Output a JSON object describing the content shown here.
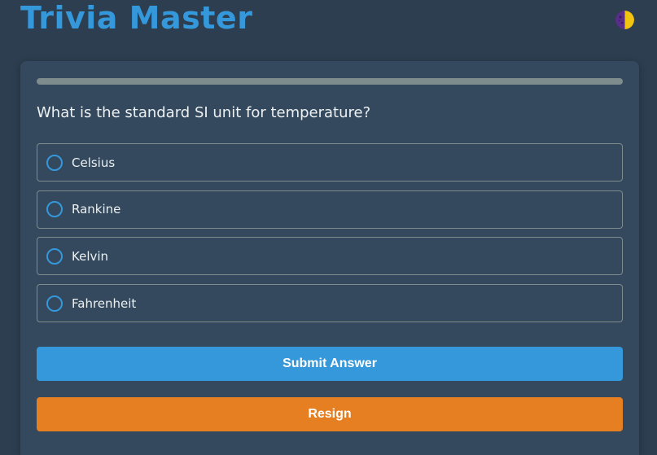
{
  "header": {
    "title": "Trivia Master",
    "theme_toggle_icon": "half-moon-icon"
  },
  "quiz": {
    "progress_fraction": 0.0,
    "question": "What is the standard SI unit for temperature?",
    "options": [
      {
        "label": "Celsius"
      },
      {
        "label": "Rankine"
      },
      {
        "label": "Kelvin"
      },
      {
        "label": "Fahrenheit"
      }
    ],
    "submit_label": "Submit Answer",
    "resign_label": "Resign"
  },
  "colors": {
    "background": "#2c3e50",
    "card": "#34495e",
    "accent": "#3498db",
    "resign": "#e67e22",
    "track": "#7f8c8d",
    "text": "#ecf0f1"
  }
}
